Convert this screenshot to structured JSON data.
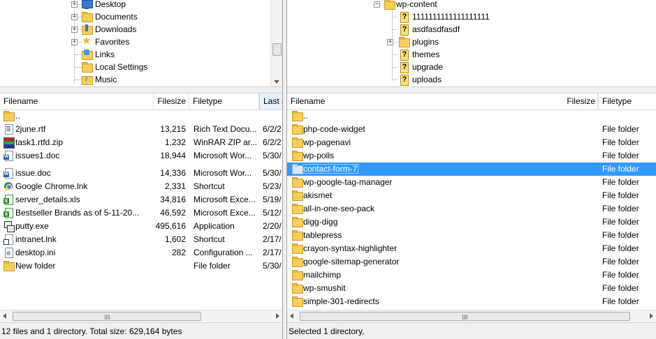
{
  "local": {
    "tree": [
      {
        "label": "Desktop",
        "icon": "desktop-icon",
        "kind": "desktop",
        "expander": "+"
      },
      {
        "label": "Documents",
        "icon": "documents-folder-icon",
        "kind": "folder",
        "expander": "+"
      },
      {
        "label": "Downloads",
        "icon": "downloads-folder-icon",
        "kind": "downloads",
        "expander": "+"
      },
      {
        "label": "Favorites",
        "icon": "favorites-icon",
        "kind": "favorites",
        "expander": "+"
      },
      {
        "label": "Links",
        "icon": "links-folder-icon",
        "kind": "links",
        "expander": ""
      },
      {
        "label": "Local Settings",
        "icon": "folder-icon",
        "kind": "folder",
        "expander": ""
      },
      {
        "label": "Music",
        "icon": "music-folder-icon",
        "kind": "music",
        "expander": ""
      }
    ],
    "columns": {
      "filename": "Filename",
      "filesize": "Filesize",
      "filetype": "Filetype",
      "last_modified": "Last m"
    },
    "files": [
      {
        "name": "..",
        "size": "",
        "type": "",
        "date": "",
        "icon": "parent-folder-icon",
        "kind": "folder"
      },
      {
        "name": "2june.rtf",
        "size": "13,215",
        "type": "Rich Text Docu...",
        "date": "6/2/2",
        "icon": "rtf-file-icon",
        "kind": "rtf"
      },
      {
        "name": "task1.rtfd.zip",
        "size": "1,232",
        "type": "WinRAR ZIP ar...",
        "date": "6/2/2",
        "icon": "zip-file-icon",
        "kind": "zip"
      },
      {
        "name": "issues1.doc",
        "size": "18,944",
        "type": "Microsoft Wor...",
        "date": "5/30/",
        "icon": "word-doc-icon",
        "kind": "word"
      },
      {
        "name": "issue.doc",
        "size": "14,336",
        "type": "Microsoft Wor...",
        "date": "5/30/",
        "icon": "word-doc-icon",
        "kind": "word"
      },
      {
        "name": "Google Chrome.lnk",
        "size": "2,331",
        "type": "Shortcut",
        "date": "5/23/",
        "icon": "chrome-icon",
        "kind": "chrome"
      },
      {
        "name": "server_details.xls",
        "size": "34,816",
        "type": "Microsoft Exce...",
        "date": "5/19/",
        "icon": "excel-file-icon",
        "kind": "xls"
      },
      {
        "name": "Bestseller Brands as of 5-11-20...",
        "size": "46,592",
        "type": "Microsoft Exce...",
        "date": "5/12/",
        "icon": "excel-file-icon",
        "kind": "xls"
      },
      {
        "name": "putty.exe",
        "size": "495,616",
        "type": "Application",
        "date": "2/20/",
        "icon": "putty-icon",
        "kind": "putty"
      },
      {
        "name": "intranet.lnk",
        "size": "1,602",
        "type": "Shortcut",
        "date": "2/17/",
        "icon": "shortcut-icon",
        "kind": "intranet"
      },
      {
        "name": "desktop.ini",
        "size": "282",
        "type": "Configuration ...",
        "date": "2/17/",
        "icon": "settings-file-icon",
        "kind": "ini"
      },
      {
        "name": "New folder",
        "size": "",
        "type": "File folder",
        "date": "5/30/",
        "icon": "folder-icon",
        "kind": "folder"
      }
    ],
    "status": "12 files and 1 directory. Total size: 629,164 bytes"
  },
  "remote": {
    "tree": [
      {
        "label": "wp-content",
        "icon": "folder-icon",
        "kind": "folder",
        "expander": "−",
        "level": 0
      },
      {
        "label": "1111111111111111111",
        "icon": "unknown-folder-icon",
        "kind": "unknown",
        "expander": "",
        "level": 1
      },
      {
        "label": "asdfasdfasdf",
        "icon": "unknown-folder-icon",
        "kind": "unknown",
        "expander": "",
        "level": 1
      },
      {
        "label": "plugins",
        "icon": "folder-icon",
        "kind": "folder",
        "expander": "+",
        "level": 1
      },
      {
        "label": "themes",
        "icon": "unknown-folder-icon",
        "kind": "unknown",
        "expander": "",
        "level": 1
      },
      {
        "label": "upgrade",
        "icon": "unknown-folder-icon",
        "kind": "unknown",
        "expander": "",
        "level": 1
      },
      {
        "label": "uploads",
        "icon": "unknown-folder-icon",
        "kind": "unknown",
        "expander": "",
        "level": 1
      }
    ],
    "columns": {
      "filename": "Filename",
      "filesize": "Filesize",
      "filetype": "Filetype"
    },
    "files": [
      {
        "name": "..",
        "type": "",
        "icon": "parent-folder-icon"
      },
      {
        "name": "php-code-widget",
        "type": "File folder",
        "icon": "folder-icon"
      },
      {
        "name": "wp-pagenavi",
        "type": "File folder",
        "icon": "folder-icon"
      },
      {
        "name": "wp-polls",
        "type": "File folder",
        "icon": "folder-icon"
      },
      {
        "name": "contact-form-7",
        "type": "File folder",
        "icon": "folder-icon",
        "selected": true
      },
      {
        "name": "wp-google-tag-manager",
        "type": "File folder",
        "icon": "folder-icon"
      },
      {
        "name": "akismet",
        "type": "File folder",
        "icon": "folder-icon"
      },
      {
        "name": "all-in-one-seo-pack",
        "type": "File folder",
        "icon": "folder-icon"
      },
      {
        "name": "digg-digg",
        "type": "File folder",
        "icon": "folder-icon"
      },
      {
        "name": "tablepress",
        "type": "File folder",
        "icon": "folder-icon"
      },
      {
        "name": "crayon-syntax-highlighter",
        "type": "File folder",
        "icon": "folder-icon"
      },
      {
        "name": "google-sitemap-generator",
        "type": "File folder",
        "icon": "folder-icon"
      },
      {
        "name": "mailchimp",
        "type": "File folder",
        "icon": "folder-icon"
      },
      {
        "name": "wp-smushit",
        "type": "File folder",
        "icon": "folder-icon"
      },
      {
        "name": "simple-301-redirects",
        "type": "File folder",
        "icon": "folder-icon"
      }
    ],
    "status": "Selected 1 directory."
  },
  "colors": {
    "selection": "#3399ff",
    "folder": "#f5cf5b",
    "statusbar": "#f0f0f0"
  }
}
